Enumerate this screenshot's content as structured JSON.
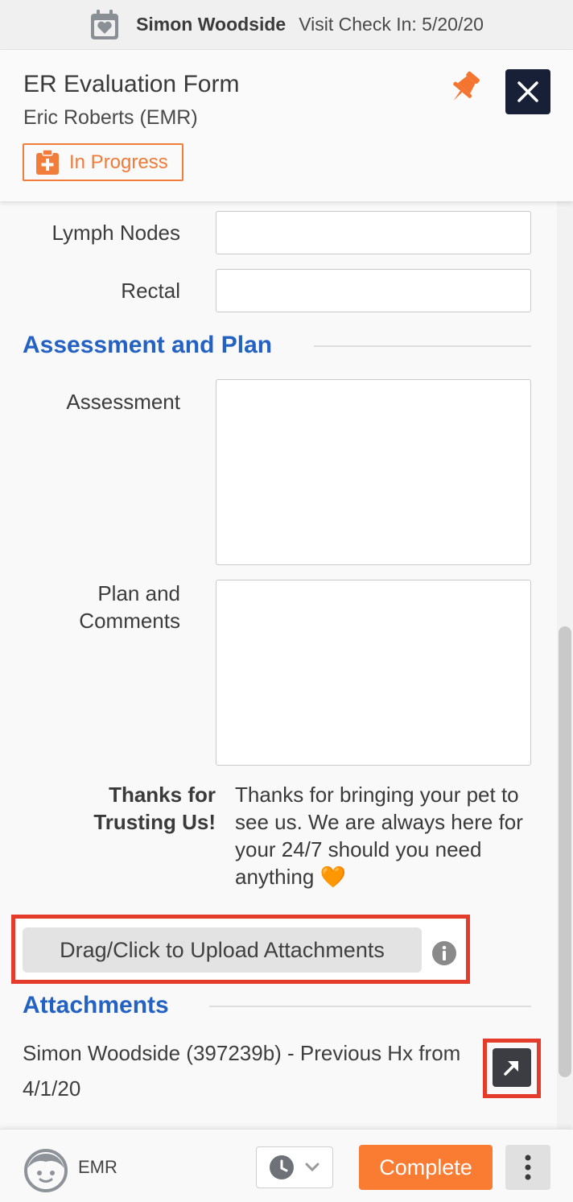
{
  "patient_bar": {
    "patient_name": "Simon Woodside",
    "visit_check_in": "Visit Check In: 5/20/20"
  },
  "form_header": {
    "title": "ER Evaluation Form",
    "author": "Eric Roberts (EMR)",
    "status": "In Progress"
  },
  "fields": {
    "lymph_nodes": {
      "label": "Lymph Nodes",
      "value": ""
    },
    "rectal": {
      "label": "Rectal",
      "value": ""
    }
  },
  "assessment_section": {
    "title": "Assessment and Plan",
    "assessment": {
      "label": "Assessment",
      "value": ""
    },
    "plan_label_line1": "Plan and",
    "plan_label_line2": "Comments",
    "plan_value": ""
  },
  "thanks": {
    "label_line1": "Thanks for",
    "label_line2": "Trusting Us!",
    "text": "Thanks for bringing your pet to see us. We are always here for your 24/7 should you need anything 🧡"
  },
  "upload": {
    "button_label": "Drag/Click to Upload Attachments"
  },
  "attachments": {
    "title": "Attachments",
    "items": [
      {
        "name": "Simon Woodside (397239b) - Previous Hx from 4/1/20"
      }
    ]
  },
  "bottom_bar": {
    "user_label": "EMR",
    "complete_label": "Complete"
  },
  "colors": {
    "accent_orange": "#f97c32",
    "section_blue": "#2362c2",
    "close_navy": "#172036",
    "highlight_red": "#e53b2a"
  },
  "icons": {
    "patient_bar": "calendar-heart-icon",
    "status": "clipboard-plus-icon",
    "pin": "pushpin-icon",
    "close": "close-icon",
    "info": "info-icon",
    "open_attachment": "arrow-up-right-icon",
    "avatar": "user-face-icon",
    "history": "clock-icon",
    "dropdown": "chevron-down-icon",
    "more": "vertical-dots-icon"
  }
}
